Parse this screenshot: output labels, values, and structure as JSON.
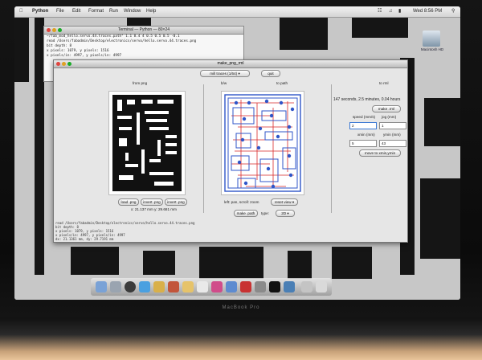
{
  "menubar": {
    "app_name": "Python",
    "menus": [
      "File",
      "Edit",
      "Format",
      "Run",
      "Window",
      "Help"
    ],
    "clock": "Wed 8:56 PM"
  },
  "terminal": {
    "title": "Terminal — Python — 80×24",
    "lines": [
      "~/fab_mod_hello.servo.44.traces.path\" 1.1 8.4 4 0.5 0.5 0.5 -0.1",
      "read /Users/fabadmin/Desktop/electronics/servo/hello.servo.44.traces.png",
      "  bit depth: 8",
      "  x pixels: 1079, y pixels: 1516",
      "  x pixels/in: 4997, y pixels/in: 4997"
    ]
  },
  "window": {
    "title": "make_png_rml",
    "dropdown": "mill traces (1/64)",
    "quit_label": "quit",
    "section_from_png": "from png",
    "section_bw": "b/w",
    "section_to_path": "to path",
    "section_to_rml": "to rml",
    "info": "147 seconds, 2.5 minutes, 0.04 hours",
    "make_rml_label": "make .rml",
    "speed_label": "speed (mm/s)",
    "jog_label": "jog (mm)",
    "speed_value": "2",
    "jog_value": "1",
    "xmin_label": "xmin (mm)",
    "ymin_label": "ymin (mm)",
    "xmin_value": "5",
    "ymin_value": "43",
    "move_label": "move to xmin,ymin",
    "load_png_label": "load .png",
    "invert_label": "invert .png",
    "invert2_label": "invert .png",
    "dims": "x: 21.137 mm  y: 29.681 mm",
    "pan_label": "left: pan, scroll: zoom",
    "reset_view_label": "reset view",
    "make_path_label": "make .path",
    "type_label": "type:",
    "type_value": "2D",
    "log_lines": [
      "read /Users/fabadmin/Desktop/electronics/servo/hello.servo.44.traces.png",
      "  bit depth: 8",
      "  x pixels: 1079, y pixels: 1516",
      "  x pixels/in: 4997, y pixels/in: 4997",
      "  dx: 21.1361 mm, dy: 29.7191 mm"
    ]
  },
  "desktop": {
    "drive_label": "Macintosh HD"
  },
  "laptop": {
    "brand": "MacBook Pro"
  },
  "colors": {
    "trace_red": "#d92a2a",
    "trace_blue": "#2f55c8"
  }
}
